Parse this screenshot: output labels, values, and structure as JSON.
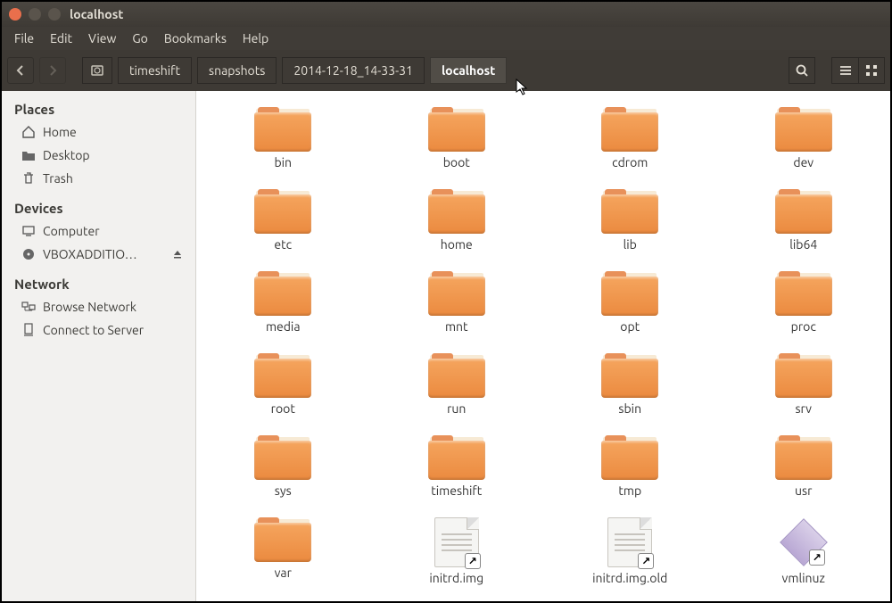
{
  "window": {
    "title": "localhost"
  },
  "menubar": [
    "File",
    "Edit",
    "View",
    "Go",
    "Bookmarks",
    "Help"
  ],
  "breadcrumbs": [
    "timeshift",
    "snapshots",
    "2014-12-18_14-33-31",
    "localhost"
  ],
  "breadcrumb_active_index": 3,
  "sidebar": {
    "places": {
      "title": "Places",
      "items": [
        "Home",
        "Desktop",
        "Trash"
      ]
    },
    "devices": {
      "title": "Devices",
      "items": [
        "Computer",
        "VBOXADDITIO…"
      ]
    },
    "network": {
      "title": "Network",
      "items": [
        "Browse Network",
        "Connect to Server"
      ]
    }
  },
  "files": [
    {
      "name": "bin",
      "type": "folder"
    },
    {
      "name": "boot",
      "type": "folder"
    },
    {
      "name": "cdrom",
      "type": "folder"
    },
    {
      "name": "dev",
      "type": "folder"
    },
    {
      "name": "etc",
      "type": "folder"
    },
    {
      "name": "home",
      "type": "folder"
    },
    {
      "name": "lib",
      "type": "folder"
    },
    {
      "name": "lib64",
      "type": "folder"
    },
    {
      "name": "media",
      "type": "folder"
    },
    {
      "name": "mnt",
      "type": "folder"
    },
    {
      "name": "opt",
      "type": "folder"
    },
    {
      "name": "proc",
      "type": "folder"
    },
    {
      "name": "root",
      "type": "folder"
    },
    {
      "name": "run",
      "type": "folder"
    },
    {
      "name": "sbin",
      "type": "folder"
    },
    {
      "name": "srv",
      "type": "folder"
    },
    {
      "name": "sys",
      "type": "folder"
    },
    {
      "name": "timeshift",
      "type": "folder"
    },
    {
      "name": "tmp",
      "type": "folder"
    },
    {
      "name": "usr",
      "type": "folder"
    },
    {
      "name": "var",
      "type": "folder"
    },
    {
      "name": "initrd.img",
      "type": "link"
    },
    {
      "name": "initrd.img.old",
      "type": "link"
    },
    {
      "name": "vmlinuz",
      "type": "diamond-link"
    }
  ]
}
